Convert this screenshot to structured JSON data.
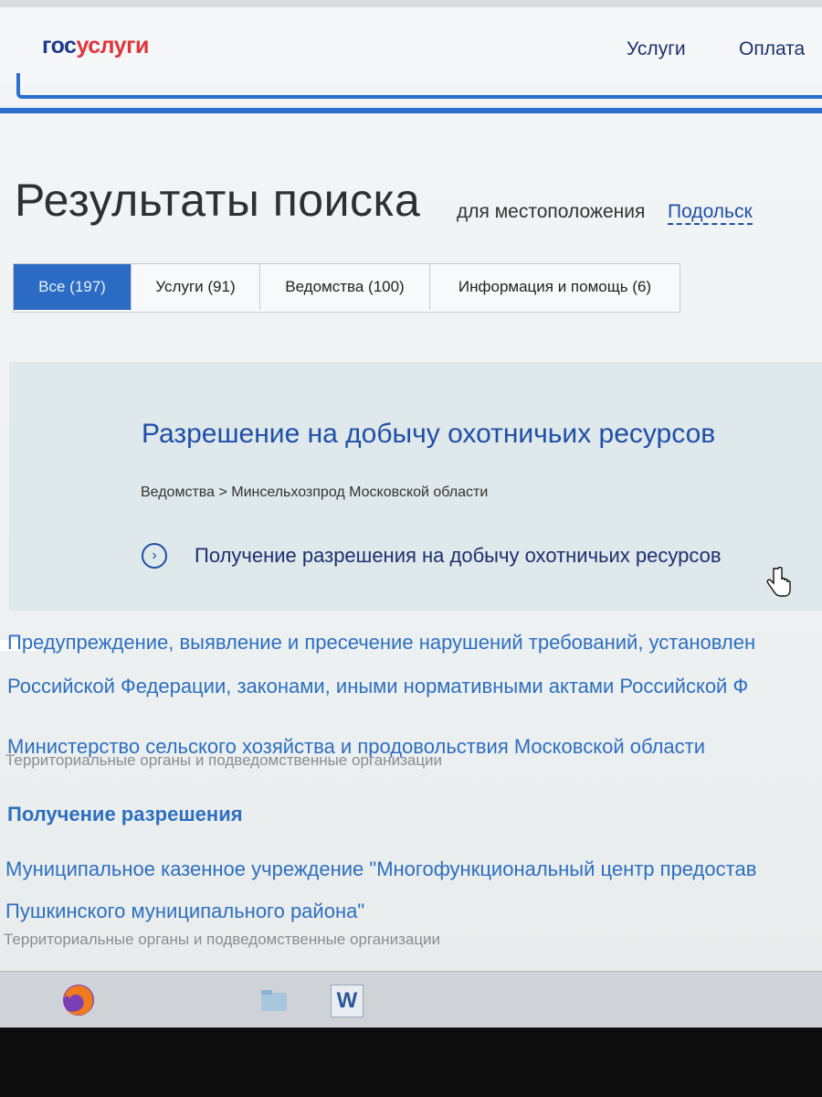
{
  "header": {
    "logo_gos": "гос",
    "logo_uslugi": "услуги",
    "nav": [
      {
        "label": "Услуги"
      },
      {
        "label": "Оплата"
      }
    ]
  },
  "search": {
    "title": "Результаты поиска",
    "location_label": "для местоположения",
    "location_value": "Подольск"
  },
  "tabs": [
    {
      "label": "Все (197)",
      "active": true
    },
    {
      "label": "Услуги (91)",
      "active": false
    },
    {
      "label": "Ведомства (100)",
      "active": false
    },
    {
      "label": "Информация и помощь (6)",
      "active": false
    }
  ],
  "top_result": {
    "title": "Разрешение на добычу охотничьих ресурсов",
    "breadcrumb": "Ведомства > Минсельхозпрод Московской области",
    "service": "Получение разрешения на добычу охотничьих ресурсов"
  },
  "results": [
    {
      "line1": "Предупреждение, выявление и пресечение нарушений требований, установлен",
      "line2": "Российской Федерации, законами, иными нормативными актами Российской Ф"
    },
    {
      "title": "Министерство сельского хозяйства и продовольствия Московской области",
      "sub": "Территориальные органы и подведомственные организации"
    },
    {
      "title": "Получение разрешения"
    },
    {
      "line1": "Муниципальное казенное учреждение \"Многофункциональный центр предостав",
      "line2": "Пушкинского муниципального района\"",
      "sub": "Территориальные органы и подведомственные организации"
    }
  ],
  "taskbar": {
    "items": [
      "firefox-icon",
      "file-explorer-icon",
      "word-icon"
    ],
    "word_letter": "W"
  },
  "colors": {
    "accent": "#2b6bc4",
    "link": "#1f4fa8",
    "brand_red": "#e0343a",
    "brand_blue": "#1d3a8c"
  }
}
